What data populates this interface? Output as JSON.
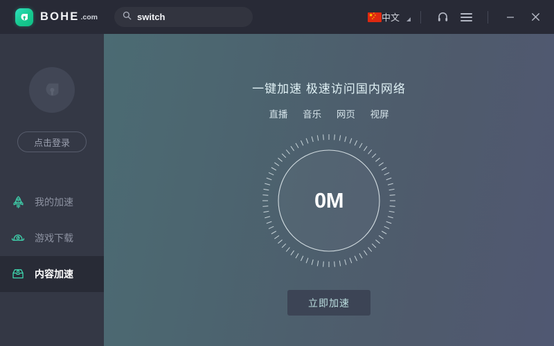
{
  "titlebar": {
    "logo": {
      "name": "BOHE",
      "suffix": ".com",
      "icon": "bohe-shield-logo"
    },
    "search": {
      "value": "switch",
      "placeholder": "switch",
      "icon": "search-icon"
    },
    "language": {
      "label": "中文",
      "flag": "china-flag",
      "caret": "dropdown-caret-icon"
    },
    "support_icon": "headset-icon",
    "menu_icon": "hamburger-menu-icon",
    "minimize_label": "─",
    "close_label": "✕"
  },
  "sidebar": {
    "avatar_icon": "user-avatar-placeholder",
    "login_label": "点击登录",
    "items": [
      {
        "label": "我的加速",
        "icon": "rocket-icon",
        "active": false
      },
      {
        "label": "游戏下载",
        "icon": "game-controller-icon",
        "active": false
      },
      {
        "label": "内容加速",
        "icon": "inbox-box-icon",
        "active": true
      }
    ]
  },
  "main": {
    "headline": "一键加速 极速访问国内网络",
    "tags": [
      "直播",
      "音乐",
      "网页",
      "视屏"
    ],
    "gauge": {
      "value": "0M",
      "ticks": 72
    },
    "cta_label": "立即加速"
  },
  "colors": {
    "titlebar_bg": "#282a36",
    "sidebar_bg": "#343845",
    "sidebar_active_bg": "#282b36",
    "accent_teal": "#2fe0c0",
    "accent_green": "#17c98f",
    "main_gradient_from": "#4b6b73",
    "main_gradient_to": "#505872",
    "cta_bg": "#3c4455",
    "cta_text": "#bcdfe0",
    "flag_red": "#de2910",
    "flag_yellow": "#ffde00"
  }
}
